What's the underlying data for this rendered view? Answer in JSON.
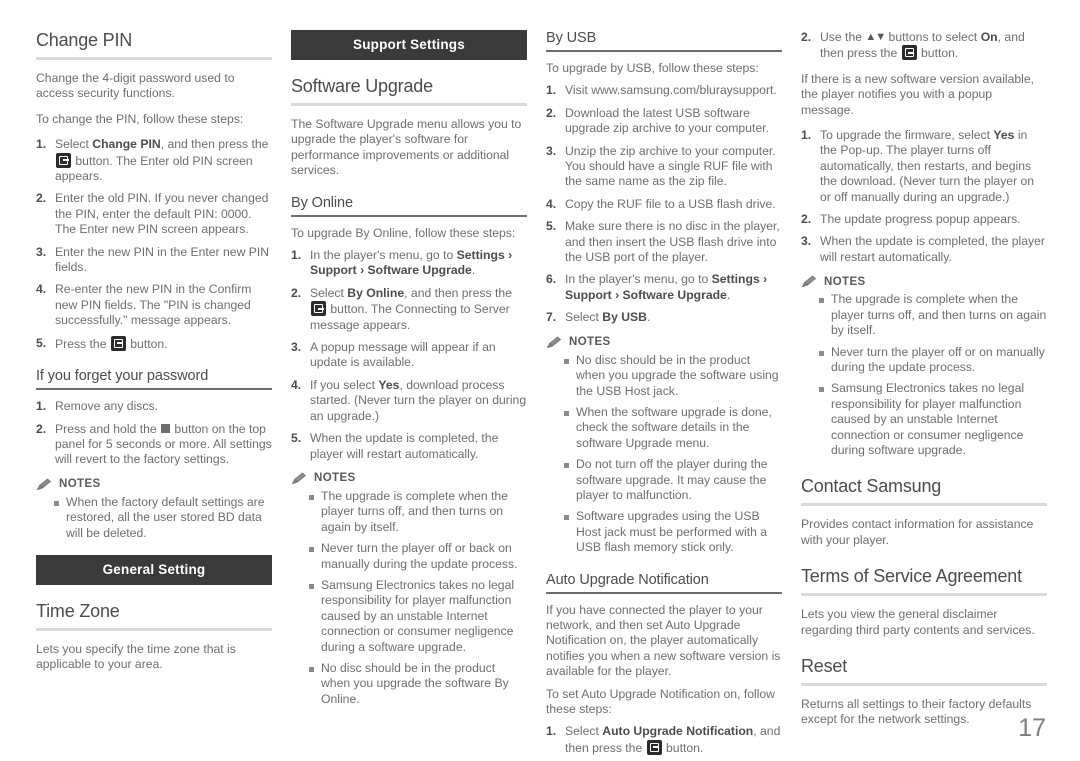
{
  "page": {
    "number": "17"
  },
  "col1": {
    "change_pin": {
      "title": "Change PIN",
      "intro1": "Change the 4-digit password used to access security functions.",
      "intro2": "To change the PIN, follow these steps:",
      "steps": [
        {
          "num": "1.",
          "pre": "Select ",
          "bold": "Change PIN",
          "mid": ", and then press the ",
          "icon": "enter-button",
          "post": " button. The Enter old PIN screen appears."
        },
        {
          "num": "2.",
          "pre": "Enter the old PIN. If you never changed the PIN, enter the default PIN: 0000. The Enter new PIN screen appears.",
          "bold": "",
          "mid": "",
          "post": ""
        },
        {
          "num": "3.",
          "pre": "Enter the new PIN in the Enter new PIN fields.",
          "bold": "",
          "mid": "",
          "post": ""
        },
        {
          "num": "4.",
          "pre": "Re-enter the new PIN in the Confirm new PIN fields. The \"PIN is changed successfully.\" message appears.",
          "bold": "",
          "mid": "",
          "post": ""
        },
        {
          "num": "5.",
          "pre": "Press the ",
          "bold": "",
          "mid": "",
          "icon": "enter-button",
          "post": " button."
        }
      ]
    },
    "forgot_password": {
      "title": "If you forget your password",
      "steps": [
        {
          "num": "1.",
          "pre": "Remove any discs.",
          "post": ""
        },
        {
          "num": "2.",
          "pre": "Press and hold the ",
          "icon": "stop-button",
          "post": " button on the top panel for 5 seconds or more. All settings will revert to the factory settings."
        }
      ],
      "notes_label": "NOTES",
      "notes": [
        "When the factory default settings are restored, all the user stored BD data will be deleted."
      ]
    },
    "general_setting_banner": "General Setting",
    "time_zone": {
      "title": "Time Zone",
      "body": "Lets you specify the time zone that is applicable to your area."
    }
  },
  "col2": {
    "support_settings_banner": "Support Settings",
    "software_upgrade": {
      "title": "Software Upgrade",
      "body": "The Software Upgrade menu allows you to upgrade the player's software for performance improvements or additional services."
    },
    "by_online": {
      "title": "By Online",
      "intro": "To upgrade By Online, follow these steps:",
      "steps": [
        {
          "num": "1.",
          "pre": "In the player's menu, go to ",
          "bold": "Settings › Support › Software Upgrade",
          "post": "."
        },
        {
          "num": "2.",
          "pre": "Select ",
          "bold": "By Online",
          "mid": ", and then press the ",
          "icon": "enter-button",
          "post": " button. The Connecting to Server message appears."
        },
        {
          "num": "3.",
          "pre": "A popup message will appear if an update is available.",
          "post": ""
        },
        {
          "num": "4.",
          "pre": "If you select ",
          "bold": "Yes",
          "post": ", download process started. (Never turn the player on during an upgrade.)"
        },
        {
          "num": "5.",
          "pre": "When the update is completed, the player will restart automatically.",
          "post": ""
        }
      ],
      "notes_label": "NOTES",
      "notes": [
        "The upgrade is complete when the player turns off, and then turns on again by itself.",
        "Never turn the player off or back on manually during the update process.",
        "Samsung Electronics takes no legal responsibility for player malfunction caused by an unstable Internet connection or consumer negligence during a software upgrade.",
        "No disc should be in the product when you upgrade the software By Online."
      ]
    }
  },
  "col3": {
    "by_usb": {
      "title": "By USB",
      "intro": "To upgrade by USB, follow these steps:",
      "steps": [
        {
          "num": "1.",
          "pre": "Visit www.samsung.com/bluraysupport.",
          "post": ""
        },
        {
          "num": "2.",
          "pre": "Download the latest USB software upgrade zip archive to your computer.",
          "post": ""
        },
        {
          "num": "3.",
          "pre": "Unzip the zip archive to your computer. You should have a single RUF file with the same name as the zip file.",
          "post": ""
        },
        {
          "num": "4.",
          "pre": "Copy the RUF file to a USB flash drive.",
          "post": ""
        },
        {
          "num": "5.",
          "pre": "Make sure there is no disc in the player, and then insert the USB flash drive into the USB port of the player.",
          "post": ""
        },
        {
          "num": "6.",
          "pre": "In the player's menu, go to ",
          "bold": "Settings › Support › Software Upgrade",
          "post": "."
        },
        {
          "num": "7.",
          "pre": "Select ",
          "bold": "By USB",
          "post": "."
        }
      ],
      "notes_label": "NOTES",
      "notes": [
        "No disc should be in the product when you upgrade the software using the USB Host jack.",
        "When the software upgrade is done, check the software details in the software Upgrade menu.",
        "Do not turn off the player during the software upgrade. It may cause the player to malfunction.",
        "Software upgrades using the USB Host jack must be performed with a USB flash memory stick only."
      ]
    },
    "auto_upgrade": {
      "title": "Auto Upgrade Notification",
      "body1": "If you have connected the player to your network, and then set Auto Upgrade Notification on, the player automatically notifies you when a new software version is available for the player.",
      "body2": "To set Auto Upgrade Notification on, follow these steps:",
      "step1": {
        "num": "1.",
        "pre": "Select ",
        "bold": "Auto Upgrade Notification",
        "mid": ", and then press the ",
        "icon": "enter-button",
        "post": " button."
      }
    }
  },
  "col4": {
    "auto_upgrade_cont": {
      "step2": {
        "num": "2.",
        "pre": "Use the ",
        "arrows": "▲▼",
        "mid": " buttons to select ",
        "bold": "On",
        "mid2": ", and then press the ",
        "icon": "enter-button",
        "post": " button."
      },
      "body": "If there is a new software version available, the player notifies you with a popup message.",
      "steps": [
        {
          "num": "1.",
          "pre": "To upgrade the firmware, select ",
          "bold": "Yes",
          "post": " in the Pop-up. The player turns off automatically, then restarts, and begins the download. (Never turn the player on or off manually during an upgrade.)"
        },
        {
          "num": "2.",
          "pre": "The update progress popup appears.",
          "post": ""
        },
        {
          "num": "3.",
          "pre": "When the update is completed, the player will restart automatically.",
          "post": ""
        }
      ],
      "notes_label": "NOTES",
      "notes": [
        "The upgrade is complete when the player turns off, and then turns on again by itself.",
        "Never turn the player off or on manually during the update process.",
        "Samsung Electronics takes no legal responsibility for player malfunction caused by an unstable Internet connection or consumer negligence during software upgrade."
      ]
    },
    "contact_samsung": {
      "title": "Contact Samsung",
      "body": "Provides contact information for assistance with your player."
    },
    "terms": {
      "title": "Terms of Service Agreement",
      "body": "Lets you view the general disclaimer regarding third party contents and services."
    },
    "reset": {
      "title": "Reset",
      "body": "Returns all settings to their factory defaults except for the network settings."
    }
  }
}
